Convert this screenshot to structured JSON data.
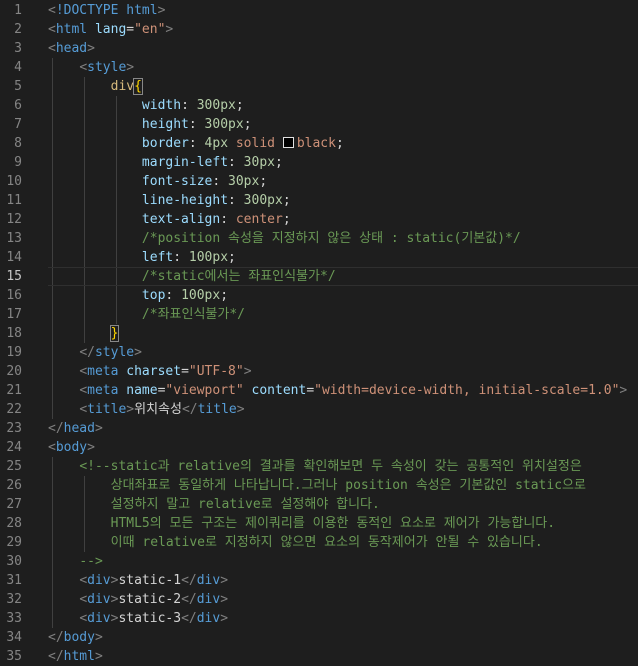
{
  "editor": {
    "lines": [
      {
        "n": "1",
        "parts": [
          [
            "br",
            "<"
          ],
          [
            "tag",
            "!DOCTYPE html"
          ],
          [
            "br",
            ">"
          ]
        ]
      },
      {
        "n": "2",
        "parts": [
          [
            "br",
            "<"
          ],
          [
            "tag",
            "html "
          ],
          [
            "attr",
            "lang"
          ],
          [
            "txt",
            "="
          ],
          [
            "str",
            "\"en\""
          ],
          [
            "br",
            ">"
          ]
        ]
      },
      {
        "n": "3",
        "parts": [
          [
            "br",
            "<"
          ],
          [
            "tag",
            "head"
          ],
          [
            "br",
            ">"
          ]
        ]
      },
      {
        "n": "4",
        "parts": [
          [
            "txt",
            "    "
          ],
          [
            "br",
            "<"
          ],
          [
            "tag",
            "style"
          ],
          [
            "br",
            ">"
          ]
        ]
      },
      {
        "n": "5",
        "parts": [
          [
            "txt",
            "        "
          ],
          [
            "sel",
            "div"
          ],
          [
            "brace",
            "{"
          ]
        ]
      },
      {
        "n": "6",
        "parts": [
          [
            "txt",
            "            "
          ],
          [
            "prop",
            "width"
          ],
          [
            "txt",
            ": "
          ],
          [
            "num",
            "300px"
          ],
          [
            "txt",
            ";"
          ]
        ]
      },
      {
        "n": "7",
        "parts": [
          [
            "txt",
            "            "
          ],
          [
            "prop",
            "height"
          ],
          [
            "txt",
            ": "
          ],
          [
            "num",
            "300px"
          ],
          [
            "txt",
            ";"
          ]
        ]
      },
      {
        "n": "8",
        "parts": [
          [
            "txt",
            "            "
          ],
          [
            "prop",
            "border"
          ],
          [
            "txt",
            ": "
          ],
          [
            "num",
            "4px"
          ],
          [
            "txt",
            " "
          ],
          [
            "val",
            "solid"
          ],
          [
            "txt",
            " "
          ],
          [
            "swatch",
            ""
          ],
          [
            "val",
            "black"
          ],
          [
            "txt",
            ";"
          ]
        ]
      },
      {
        "n": "9",
        "parts": [
          [
            "txt",
            "            "
          ],
          [
            "prop",
            "margin-left"
          ],
          [
            "txt",
            ": "
          ],
          [
            "num",
            "30px"
          ],
          [
            "txt",
            ";"
          ]
        ]
      },
      {
        "n": "10",
        "parts": [
          [
            "txt",
            "            "
          ],
          [
            "prop",
            "font-size"
          ],
          [
            "txt",
            ": "
          ],
          [
            "num",
            "30px"
          ],
          [
            "txt",
            ";"
          ]
        ]
      },
      {
        "n": "11",
        "parts": [
          [
            "txt",
            "            "
          ],
          [
            "prop",
            "line-height"
          ],
          [
            "txt",
            ": "
          ],
          [
            "num",
            "300px"
          ],
          [
            "txt",
            ";"
          ]
        ]
      },
      {
        "n": "12",
        "parts": [
          [
            "txt",
            "            "
          ],
          [
            "prop",
            "text-align"
          ],
          [
            "txt",
            ": "
          ],
          [
            "val",
            "center"
          ],
          [
            "txt",
            ";"
          ]
        ]
      },
      {
        "n": "13",
        "parts": [
          [
            "txt",
            "            "
          ],
          [
            "cmt",
            "/*position 속성을 지정하지 않은 상태 : static(기본값)*/"
          ]
        ]
      },
      {
        "n": "14",
        "parts": [
          [
            "txt",
            "            "
          ],
          [
            "prop",
            "left"
          ],
          [
            "txt",
            ": "
          ],
          [
            "num",
            "100px"
          ],
          [
            "txt",
            ";"
          ]
        ]
      },
      {
        "n": "15",
        "parts": [
          [
            "txt",
            "            "
          ],
          [
            "cmt",
            "/*static에서는 좌표인식불가*/"
          ]
        ]
      },
      {
        "n": "16",
        "parts": [
          [
            "txt",
            "            "
          ],
          [
            "prop",
            "top"
          ],
          [
            "txt",
            ": "
          ],
          [
            "num",
            "100px"
          ],
          [
            "txt",
            ";"
          ]
        ]
      },
      {
        "n": "17",
        "parts": [
          [
            "txt",
            "            "
          ],
          [
            "cmt",
            "/*좌표인식불가*/"
          ]
        ]
      },
      {
        "n": "18",
        "parts": [
          [
            "txt",
            "        "
          ],
          [
            "brace",
            "}"
          ]
        ]
      },
      {
        "n": "19",
        "parts": [
          [
            "txt",
            "    "
          ],
          [
            "br",
            "</"
          ],
          [
            "tag",
            "style"
          ],
          [
            "br",
            ">"
          ]
        ]
      },
      {
        "n": "20",
        "parts": [
          [
            "txt",
            "    "
          ],
          [
            "br",
            "<"
          ],
          [
            "tag",
            "meta "
          ],
          [
            "attr",
            "charset"
          ],
          [
            "txt",
            "="
          ],
          [
            "str",
            "\"UTF-8\""
          ],
          [
            "br",
            ">"
          ]
        ]
      },
      {
        "n": "21",
        "parts": [
          [
            "txt",
            "    "
          ],
          [
            "br",
            "<"
          ],
          [
            "tag",
            "meta "
          ],
          [
            "attr",
            "name"
          ],
          [
            "txt",
            "="
          ],
          [
            "str",
            "\"viewport\""
          ],
          [
            "txt",
            " "
          ],
          [
            "attr",
            "content"
          ],
          [
            "txt",
            "="
          ],
          [
            "str",
            "\"width=device-width, initial-scale=1.0\""
          ],
          [
            "br",
            ">"
          ]
        ]
      },
      {
        "n": "22",
        "parts": [
          [
            "txt",
            "    "
          ],
          [
            "br",
            "<"
          ],
          [
            "tag",
            "title"
          ],
          [
            "br",
            ">"
          ],
          [
            "txt",
            "위치속성"
          ],
          [
            "br",
            "</"
          ],
          [
            "tag",
            "title"
          ],
          [
            "br",
            ">"
          ]
        ]
      },
      {
        "n": "23",
        "parts": [
          [
            "br",
            "</"
          ],
          [
            "tag",
            "head"
          ],
          [
            "br",
            ">"
          ]
        ]
      },
      {
        "n": "24",
        "parts": [
          [
            "br",
            "<"
          ],
          [
            "tag",
            "body"
          ],
          [
            "br",
            ">"
          ]
        ]
      },
      {
        "n": "25",
        "parts": [
          [
            "txt",
            "    "
          ],
          [
            "cmt",
            "<!--static과 relative의 결과를 확인해보면 두 속성이 갖는 공통적인 위치설정은"
          ]
        ]
      },
      {
        "n": "26",
        "parts": [
          [
            "txt",
            "        "
          ],
          [
            "cmt",
            "상대좌표로 동일하게 나타납니다.그러나 position 속성은 기본값인 static으로"
          ]
        ]
      },
      {
        "n": "27",
        "parts": [
          [
            "txt",
            "        "
          ],
          [
            "cmt",
            "설정하지 말고 relative로 설정해야 합니다."
          ]
        ]
      },
      {
        "n": "28",
        "parts": [
          [
            "txt",
            "        "
          ],
          [
            "cmt",
            "HTML5의 모든 구조는 제이쿼리를 이용한 동적인 요소로 제어가 가능합니다."
          ]
        ]
      },
      {
        "n": "29",
        "parts": [
          [
            "txt",
            "        "
          ],
          [
            "cmt",
            "이때 relative로 지정하지 않으면 요소의 동작제어가 안될 수 있습니다."
          ]
        ]
      },
      {
        "n": "30",
        "parts": [
          [
            "txt",
            "    "
          ],
          [
            "cmt",
            "-->"
          ]
        ]
      },
      {
        "n": "31",
        "parts": [
          [
            "txt",
            "    "
          ],
          [
            "br",
            "<"
          ],
          [
            "tag",
            "div"
          ],
          [
            "br",
            ">"
          ],
          [
            "txt",
            "static-1"
          ],
          [
            "br",
            "</"
          ],
          [
            "tag",
            "div"
          ],
          [
            "br",
            ">"
          ]
        ]
      },
      {
        "n": "32",
        "parts": [
          [
            "txt",
            "    "
          ],
          [
            "br",
            "<"
          ],
          [
            "tag",
            "div"
          ],
          [
            "br",
            ">"
          ],
          [
            "txt",
            "static-2"
          ],
          [
            "br",
            "</"
          ],
          [
            "tag",
            "div"
          ],
          [
            "br",
            ">"
          ]
        ]
      },
      {
        "n": "33",
        "parts": [
          [
            "txt",
            "    "
          ],
          [
            "br",
            "<"
          ],
          [
            "tag",
            "div"
          ],
          [
            "br",
            ">"
          ],
          [
            "txt",
            "static-3"
          ],
          [
            "br",
            "</"
          ],
          [
            "tag",
            "div"
          ],
          [
            "br",
            ">"
          ]
        ]
      },
      {
        "n": "34",
        "parts": [
          [
            "br",
            "</"
          ],
          [
            "tag",
            "body"
          ],
          [
            "br",
            ">"
          ]
        ]
      },
      {
        "n": "35",
        "parts": [
          [
            "br",
            "</"
          ],
          [
            "tag",
            "html"
          ],
          [
            "br",
            ">"
          ]
        ]
      }
    ],
    "active_line": "15",
    "colors": {
      "background": "#1e1e1e",
      "tag": "#569cd6",
      "attribute": "#9cdcfe",
      "string": "#ce9178",
      "number": "#b5cea8",
      "comment": "#6a9955",
      "selector": "#d7ba7d",
      "bracket_highlight": "#ffd700"
    }
  }
}
